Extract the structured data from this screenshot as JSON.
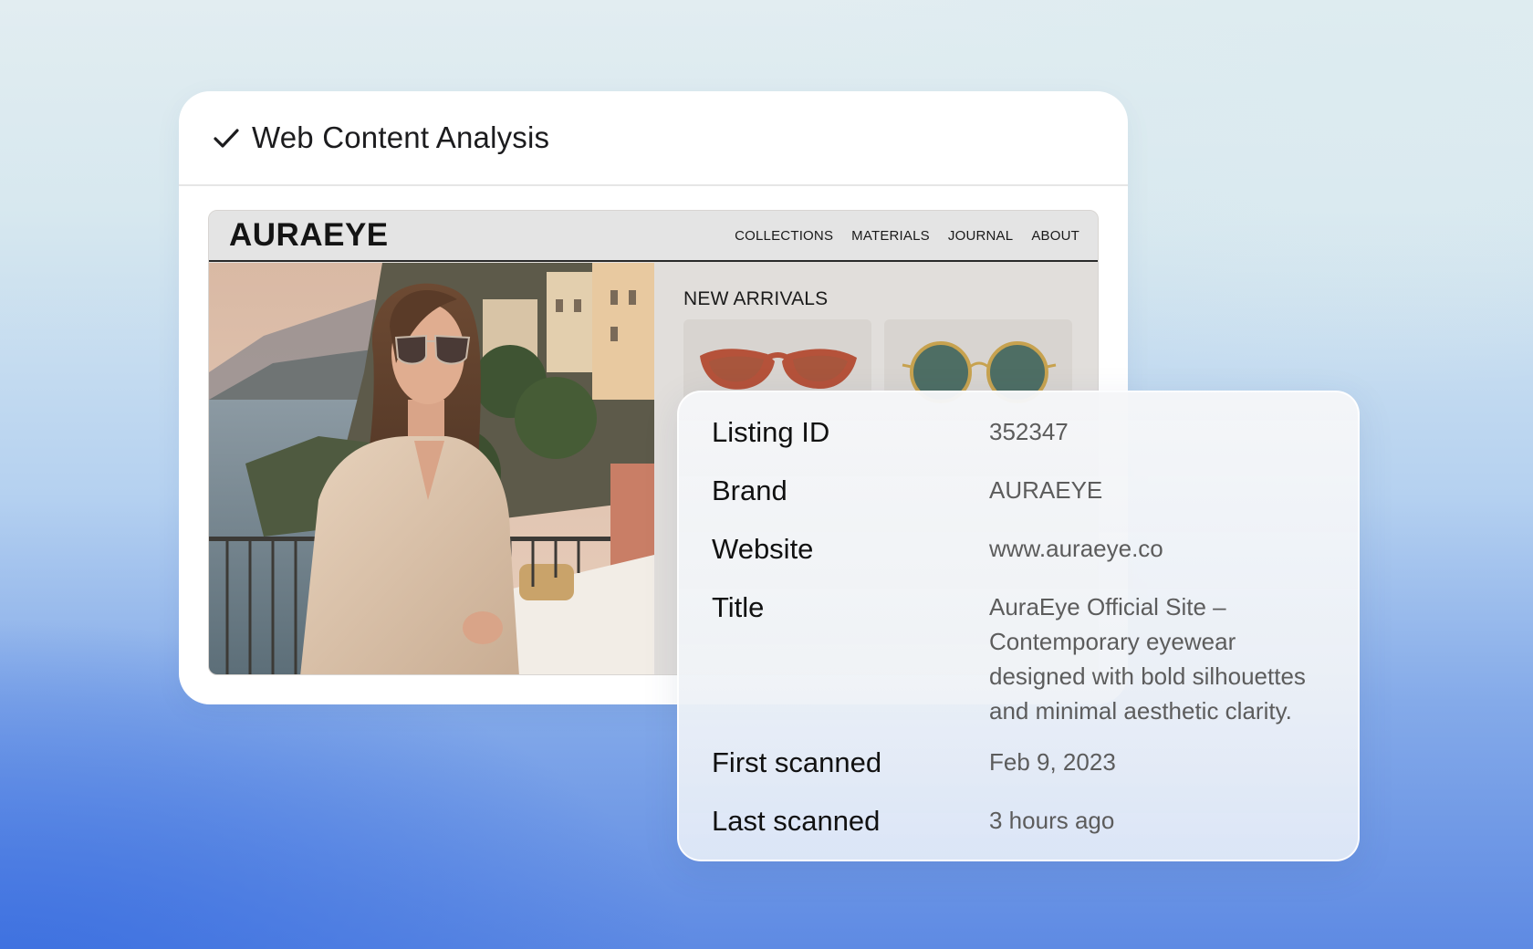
{
  "card": {
    "title": "Web Content Analysis",
    "status_icon": "check-icon"
  },
  "website": {
    "logo": "AURAEYE",
    "nav": [
      "COLLECTIONS",
      "MATERIALS",
      "JOURNAL",
      "ABOUT"
    ],
    "section_title": "NEW ARRIVALS",
    "products": [
      {
        "icon": "cat-eye-sunglasses-image",
        "color": "#b5523a"
      },
      {
        "icon": "round-sunglasses-image",
        "color": "#c7a24f"
      }
    ],
    "hero_image": "woman-wearing-sunglasses-on-coastal-terrace-photo"
  },
  "metadata": {
    "rows": [
      {
        "label": "Listing ID",
        "value": "352347"
      },
      {
        "label": "Brand",
        "value": "AURAEYE"
      },
      {
        "label": "Website",
        "value": "www.auraeye.co"
      },
      {
        "label": "Title",
        "value": "AuraEye Official Site – Contemporary eyewear designed with bold silhouettes and minimal aesthetic clarity."
      },
      {
        "label": "First scanned",
        "value": "Feb 9, 2023"
      },
      {
        "label": "Last scanned",
        "value": "3 hours ago"
      }
    ]
  }
}
